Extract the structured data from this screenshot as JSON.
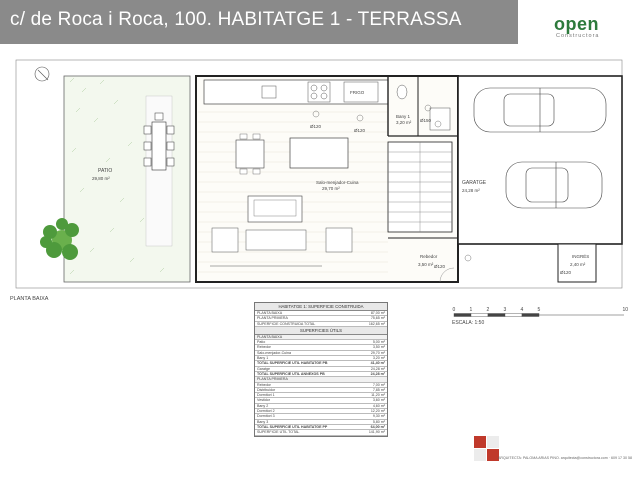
{
  "header": {
    "title": "c/ de Roca i Roca, 100. HABITATGE 1 - TERRASSA",
    "logo_word": "open",
    "logo_sub": "Constructora"
  },
  "plan": {
    "patio": {
      "name": "PATIO",
      "area": "29,80 m²"
    },
    "living": {
      "name": "Salo-menjador-Cuina",
      "area": "29,70 m²"
    },
    "bath": {
      "name": "Bany 1",
      "area": "3,20 m²"
    },
    "garage": {
      "name": "GARATGE",
      "area": "24,28 m²"
    },
    "rebedor": {
      "name": "Rebedor",
      "area": "3,50 m²"
    },
    "ingres": {
      "name": "INGRÉS",
      "area": "2,40 m²"
    },
    "fridge": "FRIGO",
    "diam_120": "Ø120",
    "diam_150": "Ø150",
    "planta_label": "PLANTA BAIXA"
  },
  "table": {
    "title": "HABITATGE 1: SUPERFICIE CONSTRUIDA",
    "top_rows": [
      {
        "label": "PLANTA BAIXA",
        "value": "87,00 m²"
      },
      {
        "label": "PLANTA PRIMERA",
        "value": "75,65 m²"
      },
      {
        "label": "SUPERFICIE CONSTRUIDA TOTAL",
        "value": "162,65 m²"
      }
    ],
    "subtitle": "SUPERFICIES ÚTILS",
    "pb_label": "PLANTA BAIXA",
    "pb_rows": [
      {
        "label": "Patio",
        "value": "5,00 m²"
      },
      {
        "label": "Rebedor",
        "value": "3,50 m²"
      },
      {
        "label": "Salo-menjador-Cuina",
        "value": "29,70 m²"
      },
      {
        "label": "Bany 1",
        "value": "3,20 m²"
      },
      {
        "label": "TOTAL SUPERFICIE UTIL HABITATGE PB",
        "value": "41,40 m²"
      },
      {
        "label": "Garatge",
        "value": "24,28 m²"
      },
      {
        "label": "TOTAL SUPERFICIE UTIL ANNEXOS PB",
        "value": "24,28 m²"
      }
    ],
    "pp_label": "PLANTA PRIMERA",
    "pp_rows": [
      {
        "label": "Rebedor",
        "value": "7,00 m²"
      },
      {
        "label": "Distribuidor",
        "value": "7,85 m²"
      },
      {
        "label": "Dormitori 1",
        "value": "11,20 m²"
      },
      {
        "label": "Vestidor",
        "value": "3,60 m²"
      },
      {
        "label": "Bany 2",
        "value": "4,60 m²"
      },
      {
        "label": "Dormitori 2",
        "value": "12,20 m²"
      },
      {
        "label": "Dormitori 3",
        "value": "9,30 m²"
      },
      {
        "label": "Bany 3",
        "value": "5,80 m²"
      },
      {
        "label": "TOTAL SUPERFICIE UTIL HABITATGE PP",
        "value": "64,00 m²"
      },
      {
        "label": "SUPERFICIE UTIL TOTAL",
        "value": "141,90 m²"
      }
    ]
  },
  "scale": {
    "label": "ESCALA: 1:50",
    "ticks": [
      "0",
      "1",
      "2",
      "3",
      "4",
      "5",
      "10"
    ]
  },
  "footer": {
    "text": "ARQUITECTA: PALOMA ARIAS PINO. arquitecta@constructora.com · 609 17 30 58"
  },
  "colors": {
    "header_bar": "#8a8a8a",
    "logo_green": "#2d7a3c",
    "footer_red": "#c0392b"
  }
}
